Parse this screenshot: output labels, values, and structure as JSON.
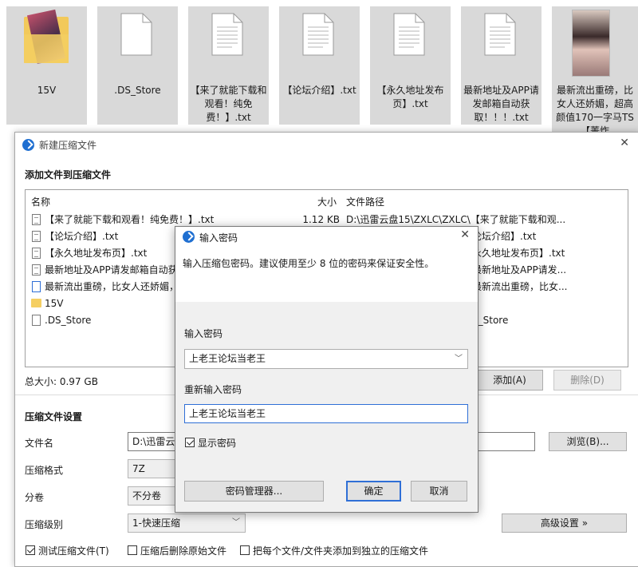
{
  "desktop": {
    "tiles": [
      {
        "label": "15V"
      },
      {
        "label": ".DS_Store"
      },
      {
        "label": "【来了就能下载和观看！纯免费！】.txt"
      },
      {
        "label": "【论坛介绍】.txt"
      },
      {
        "label": "【永久地址发布页】.txt"
      },
      {
        "label": "最新地址及APP请发邮箱自动获取！！！.txt"
      },
      {
        "label": "最新流出重磅，比女人还娇媚，超高颜值170一字马TS【菁炸"
      }
    ]
  },
  "main_window": {
    "title": "新建压缩文件",
    "close": "✕",
    "add_section_title": "添加文件到压缩文件",
    "columns": {
      "name": "名称",
      "size": "大小",
      "path": "文件路径"
    },
    "files": [
      {
        "name": "【来了就能下载和观看！纯免费！】.txt",
        "size": "1.12 KB",
        "path": "D:\\迅雷云盘15\\ZXLC\\ZXLC\\【来了就能下载和观...",
        "icon": "txt"
      },
      {
        "name": "【论坛介绍】.txt",
        "size": "",
        "path": "论坛介绍】.txt",
        "icon": "txt"
      },
      {
        "name": "【永久地址发布页】.txt",
        "size": "",
        "path": "永久地址发布页】.txt",
        "icon": "txt"
      },
      {
        "name": "最新地址及APP请发邮箱自动获",
        "size": "",
        "path": "最新地址及APP请发...",
        "icon": "txt"
      },
      {
        "name": "最新流出重磅，比女人还娇媚，",
        "size": "",
        "path": "最新流出重磅，比女...",
        "icon": "media"
      },
      {
        "name": "15V",
        "size": "",
        "path": "V",
        "icon": "folder"
      },
      {
        "name": ".DS_Store",
        "size": "",
        "path": "S_Store",
        "icon": "blank"
      }
    ],
    "total_size": "总大小: 0.97 GB",
    "add_button": "添加(A)",
    "delete_button": "删除(D)",
    "settings_title": "压缩文件设置",
    "filename_label": "文件名",
    "filename_value": "D:\\迅雷云",
    "browse_button": "浏览(B)...",
    "format_label": "压缩格式",
    "format_value": "7Z",
    "volume_label": "分卷",
    "volume_value": "不分卷",
    "level_label": "压缩级别",
    "level_value": "1-快速压缩",
    "advanced_button": "高级设置 »",
    "options": [
      {
        "label": "测试压缩文件(T)",
        "checked": true
      },
      {
        "label": "压缩后删除原始文件",
        "checked": false
      },
      {
        "label": "把每个文件/文件夹添加到独立的压缩文件",
        "checked": false
      }
    ]
  },
  "password_dialog": {
    "title": "输入密码",
    "close": "✕",
    "hint": "输入压缩包密码。建议使用至少 8 位的密码来保证安全性。",
    "password_label": "输入密码",
    "password_value": "上老王论坛当老王",
    "repeat_label": "重新输入密码",
    "repeat_value": "上老王论坛当老王",
    "show_password_label": "显示密码",
    "show_password_checked": true,
    "manager_button": "密码管理器...",
    "ok_button": "确定",
    "cancel_button": "取消"
  },
  "colors": {
    "accent": "#1f6fd1",
    "folder": "#f5cf62",
    "tile_bg": "#d9d9d9"
  }
}
